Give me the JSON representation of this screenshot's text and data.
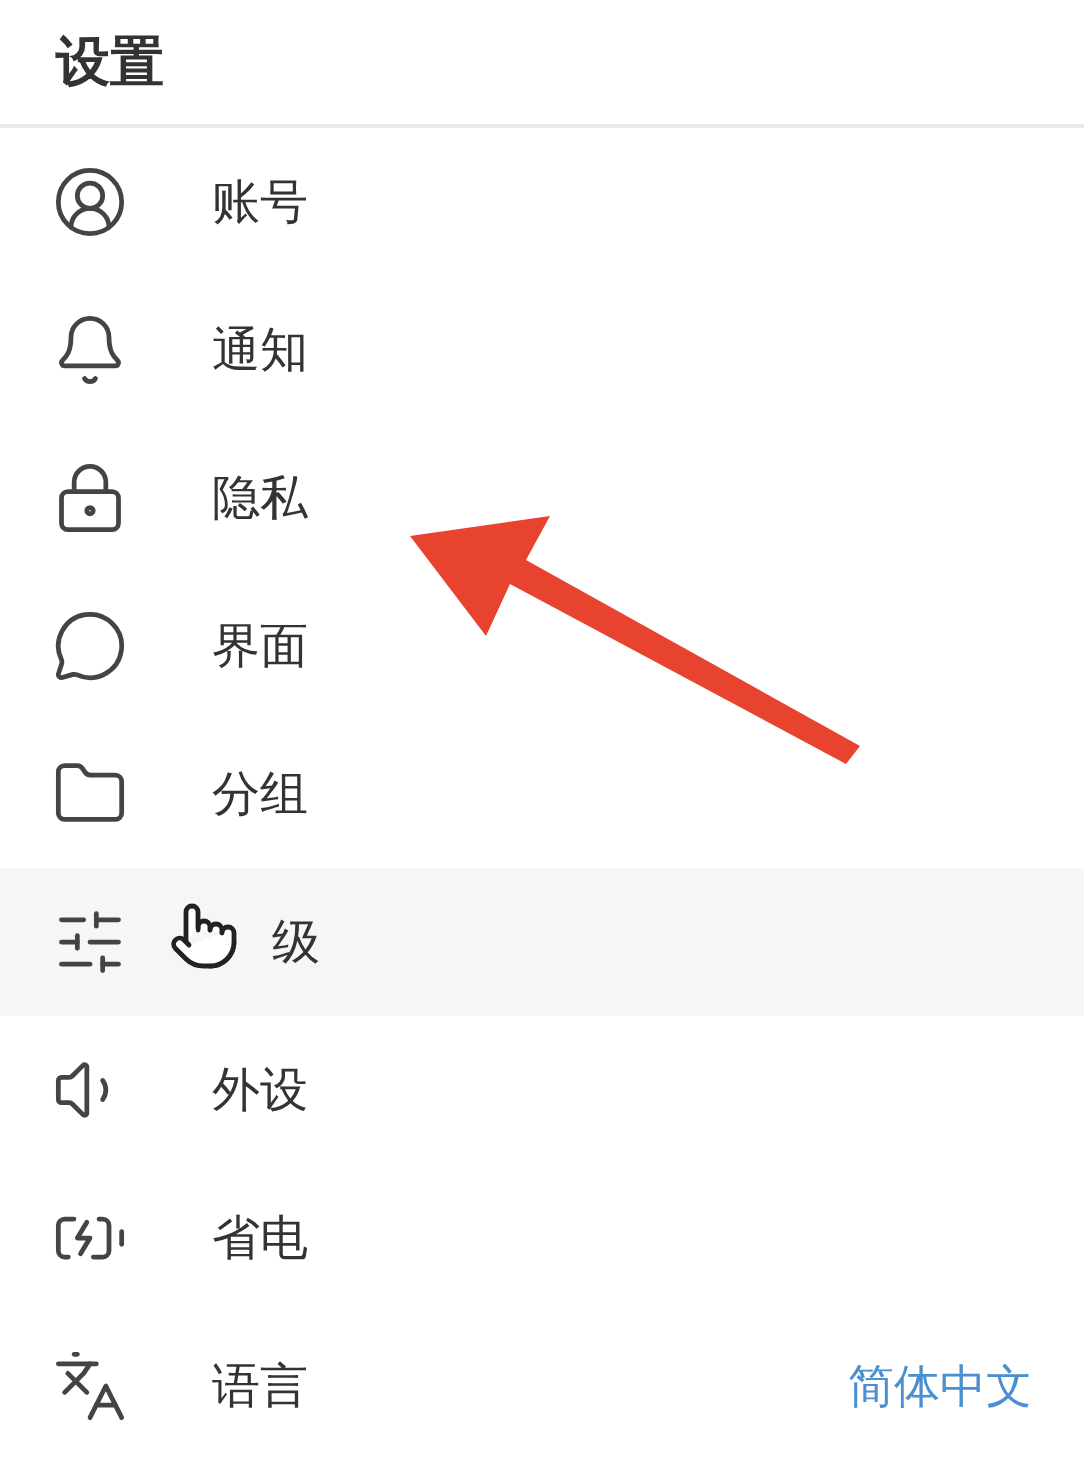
{
  "header": {
    "title": "设置"
  },
  "items": [
    {
      "label": "账号",
      "highlighted": false
    },
    {
      "label": "通知",
      "highlighted": false
    },
    {
      "label": "隐私",
      "highlighted": false
    },
    {
      "label": "界面",
      "highlighted": false
    },
    {
      "label": "分组",
      "highlighted": false
    },
    {
      "label": "级",
      "highlighted": true
    },
    {
      "label": "外设",
      "highlighted": false
    },
    {
      "label": "省电",
      "highlighted": false
    },
    {
      "label": "语言",
      "highlighted": false,
      "value": "简体中文"
    }
  ]
}
